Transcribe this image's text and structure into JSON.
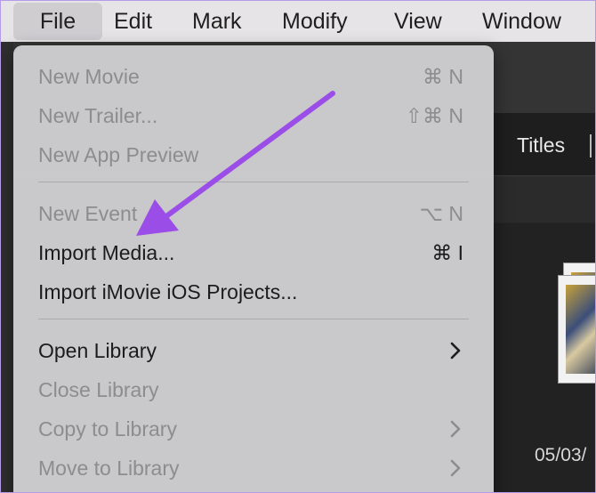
{
  "menubar": {
    "items": [
      {
        "label": "File",
        "active": true
      },
      {
        "label": "Edit"
      },
      {
        "label": "Mark"
      },
      {
        "label": "Modify"
      },
      {
        "label": "View"
      },
      {
        "label": "Window"
      }
    ]
  },
  "background_app": {
    "tab_titles": "Titles",
    "date": "05/03/"
  },
  "file_menu": {
    "items": [
      {
        "label": "New Movie",
        "shortcut": "⌘ N",
        "enabled": false
      },
      {
        "label": "New Trailer...",
        "shortcut": "⇧⌘ N",
        "enabled": false
      },
      {
        "label": "New App Preview",
        "shortcut": "",
        "enabled": false
      },
      {
        "label": "New Event",
        "shortcut": "⌥ N",
        "enabled": false
      },
      {
        "label": "Import Media...",
        "shortcut": "⌘ I",
        "enabled": true
      },
      {
        "label": "Import iMovie iOS Projects...",
        "shortcut": "",
        "enabled": true
      },
      {
        "label": "Open Library",
        "submenu": true,
        "enabled": true
      },
      {
        "label": "Close Library",
        "enabled": false
      },
      {
        "label": "Copy to Library",
        "submenu": true,
        "enabled": false
      },
      {
        "label": "Move to Library",
        "submenu": true,
        "enabled": false
      }
    ]
  },
  "annotation": {
    "arrow_color": "#9b4de8",
    "points_to": "Import Media..."
  }
}
